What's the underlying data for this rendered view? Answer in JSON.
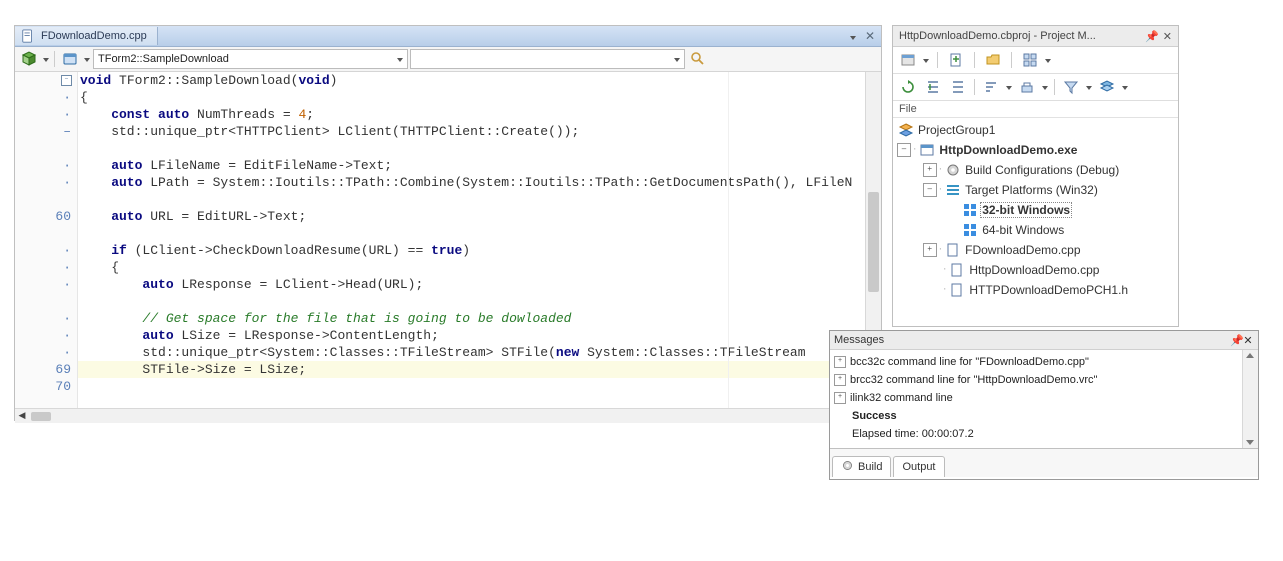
{
  "editor": {
    "tab": {
      "filename": "FDownloadDemo.cpp"
    },
    "toolbar": {
      "func_combo": "TForm2::SampleDownload"
    },
    "gutter_numbers": {
      "l7": "60",
      "l17": "69",
      "l18": "70"
    },
    "code": {
      "l0_a": "void",
      "l0_b": " TForm2::SampleDownload(",
      "l0_c": "void",
      "l0_d": ")",
      "l1": "{",
      "l2_a": "    const auto",
      "l2_b": " NumThreads = ",
      "l2_c": "4",
      "l2_d": ";",
      "l3_a": "    std::unique_ptr<THTTPClient> LClient(THTTPClient::Create());",
      "l4": "",
      "l5_a": "    auto",
      "l5_b": " LFileName = EditFileName->Text;",
      "l6_a": "    auto",
      "l6_b": " LPath = System::Ioutils::TPath::Combine(System::Ioutils::TPath::GetDocumentsPath(), LFileN",
      "l7": "",
      "l8_a": "    auto",
      "l8_b": " URL = EditURL->Text;",
      "l9": "",
      "l10_a": "    if",
      "l10_b": " (LClient->CheckDownloadResume(URL) == ",
      "l10_c": "true",
      "l10_d": ")",
      "l11": "    {",
      "l12_a": "        auto",
      "l12_b": " LResponse = LClient->Head(URL);",
      "l13": "",
      "l14": "        // Get space for the file that is going to be dowloaded",
      "l15_a": "        auto",
      "l15_b": " LSize = LResponse->ContentLength;",
      "l16_a": "        std::unique_ptr<System::Classes::TFileStream> STFile(",
      "l16_b": "new",
      "l16_c": " System::Classes::TFileStream",
      "l17": "        STFile->Size = LSize;",
      "l18": ""
    }
  },
  "pm": {
    "title": "HttpDownloadDemo.cbproj - Project M...",
    "subhdr": "File",
    "nodes": {
      "root": "ProjectGroup1",
      "exe": "HttpDownloadDemo.exe",
      "build": "Build Configurations (Debug)",
      "tp": "Target Platforms (Win32)",
      "w32": "32-bit Windows",
      "w64": "64-bit Windows",
      "f1": "FDownloadDemo.cpp",
      "f2": "HttpDownloadDemo.cpp",
      "f3": "HTTPDownloadDemoPCH1.h"
    }
  },
  "messages": {
    "title": "Messages",
    "lines": {
      "l0": "bcc32c command line for \"FDownloadDemo.cpp\"",
      "l1": "brcc32 command line for \"HttpDownloadDemo.vrc\"",
      "l2": "ilink32 command line",
      "l3": "Success",
      "l4": "Elapsed time: 00:00:07.2"
    },
    "tabs": {
      "build": "Build",
      "output": "Output"
    }
  }
}
